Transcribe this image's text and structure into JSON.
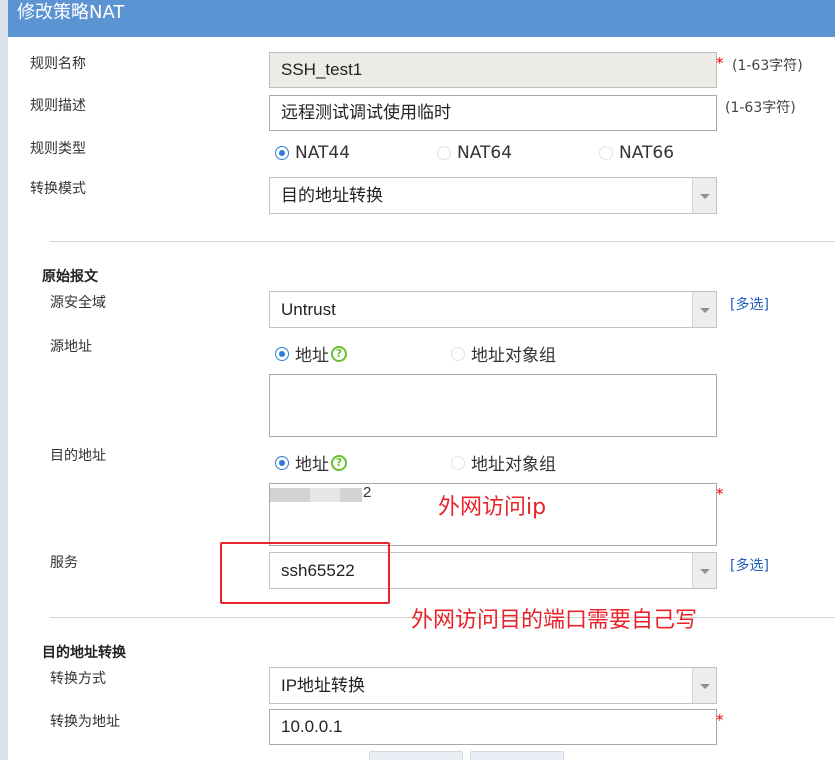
{
  "dialog": {
    "title": "修改策略NAT"
  },
  "form": {
    "rule_name_label": "规则名称",
    "rule_name_value": "SSH_test1",
    "rule_name_hint": "(1-63字符)",
    "rule_desc_label": "规则描述",
    "rule_desc_value": "远程测试调试使用临时",
    "rule_desc_hint": "(1-63字符)",
    "rule_type_label": "规则类型",
    "rule_type_options": [
      "NAT44",
      "NAT64",
      "NAT66"
    ],
    "rule_type_selected": "NAT44",
    "convert_mode_label": "转换模式",
    "convert_mode_value": "目的地址转换",
    "required_mark": "*"
  },
  "original_packet": {
    "title": "原始报文",
    "src_zone_label": "源安全域",
    "src_zone_value": "Untrust",
    "multi_select": "[多选]",
    "src_addr_label": "源地址",
    "addr_option": "地址",
    "addr_group_option": "地址对象组",
    "dst_addr_label": "目的地址",
    "dst_addr_value_visible": "2",
    "service_label": "服务",
    "service_value": "ssh65522"
  },
  "dst_translation": {
    "title": "目的地址转换",
    "method_label": "转换方式",
    "method_value": "IP地址转换",
    "to_addr_label": "转换为地址",
    "to_addr_value": "10.0.0.1"
  },
  "annotations": {
    "external_ip": "外网访问ip",
    "external_port": "外网访问目的端口需要自己写",
    "color": "#e8242a"
  },
  "icons": {
    "help": "help-circle-icon",
    "dropdown": "chevron-down-icon"
  }
}
